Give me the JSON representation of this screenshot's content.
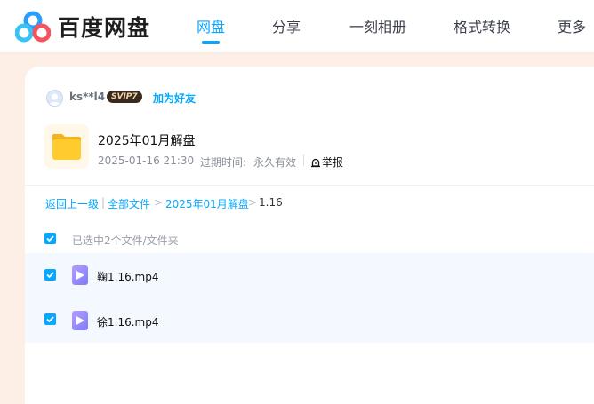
{
  "app": {
    "logo_text": "百度网盘"
  },
  "nav": {
    "items": [
      {
        "label": "网盘",
        "active": true
      },
      {
        "label": "分享",
        "active": false
      },
      {
        "label": "一刻相册",
        "active": false
      },
      {
        "label": "格式转换",
        "active": false
      },
      {
        "label": "更多",
        "active": false
      }
    ]
  },
  "sharer": {
    "username": "ks**l4",
    "vip_badge": "SVIP7",
    "add_friend": "加为好友"
  },
  "share": {
    "title": "2025年01月解盘",
    "datetime": "2025-01-16 21:30",
    "expire_label": "过期时间:",
    "expire_value": "永久有效",
    "report": "举报"
  },
  "breadcrumb": {
    "back": "返回上一级",
    "sep1": "|",
    "all_files": "全部文件",
    "arrow1": ">",
    "folder": "2025年01月解盘",
    "arrow2": ">",
    "current": "1.16"
  },
  "selection": {
    "text": "已选中2个文件/文件夹",
    "checked": true
  },
  "files": [
    {
      "name": "鞠1.16.mp4",
      "checked": true,
      "icon": "video-file-icon"
    },
    {
      "name": "徐1.16.mp4",
      "checked": true,
      "icon": "video-file-icon"
    }
  ],
  "colors": {
    "accent": "#06a7ff",
    "page_bg": "#fdeee6",
    "row_bg": "#f4f9ff"
  }
}
